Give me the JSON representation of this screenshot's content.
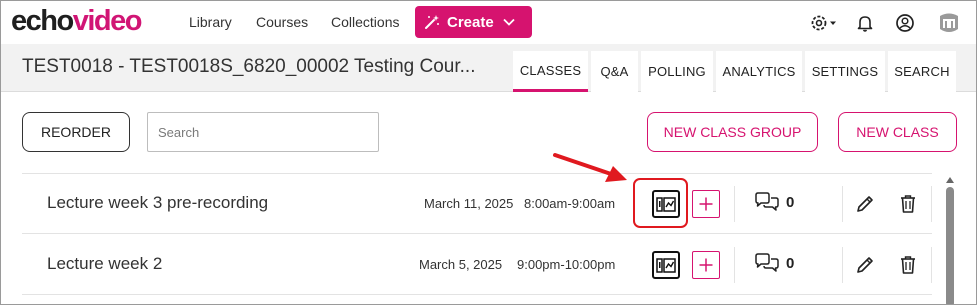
{
  "brand": {
    "part1": "echo",
    "part2": "video",
    "primary_color": "#d6136f"
  },
  "nav": {
    "links": [
      "Library",
      "Courses",
      "Collections"
    ],
    "create_label": "Create",
    "icons": [
      "gear-icon",
      "bell-icon",
      "user-icon",
      "institution-logo-icon"
    ]
  },
  "course": {
    "title": "TEST0018 - TEST0018S_6820_00002 Testing Cour...",
    "tabs": [
      "CLASSES",
      "Q&A",
      "POLLING",
      "ANALYTICS",
      "SETTINGS",
      "SEARCH"
    ],
    "active_tab": "CLASSES"
  },
  "toolbar": {
    "reorder_label": "REORDER",
    "search_placeholder": "Search",
    "new_class_group_label": "NEW CLASS GROUP",
    "new_class_label": "NEW CLASS"
  },
  "classes": [
    {
      "title": "Lecture week 3 pre-recording",
      "date": "March 11, 2025",
      "time": "8:00am-9:00am",
      "qa_count": "0"
    },
    {
      "title": "Lecture week 2",
      "date": "March 5, 2025",
      "time": "9:00pm-10:00pm",
      "qa_count": "0"
    }
  ],
  "annotation": {
    "color": "#e0191f"
  }
}
